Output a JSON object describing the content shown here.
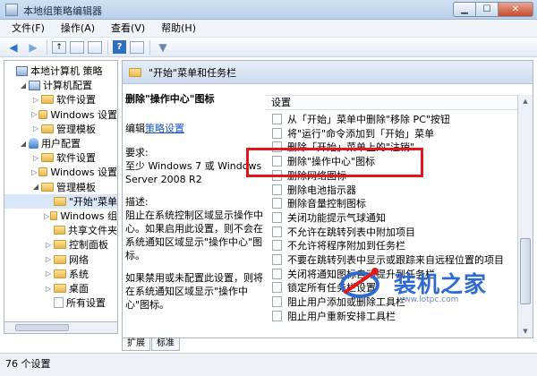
{
  "window": {
    "title": "本地组策略编辑器",
    "min_glyph": "▁",
    "max_glyph": "☐",
    "close_glyph": "✕"
  },
  "menu": [
    "文件(F)",
    "操作(A)",
    "查看(V)",
    "帮助(H)"
  ],
  "toolbar": {
    "back_glyph": "◀",
    "forward_glyph": "▶",
    "up_glyph": "↑",
    "help_glyph": "?",
    "filter_glyph": "▼"
  },
  "tree": {
    "expanded_glyph": "◢",
    "collapsed_glyph": "▷",
    "items": [
      {
        "label": "本地计算机 策略",
        "depth": 0,
        "toggle": "",
        "icon": "computer-icon"
      },
      {
        "label": "计算机配置",
        "depth": 1,
        "toggle": "expanded",
        "icon": "computer-icon"
      },
      {
        "label": "软件设置",
        "depth": 2,
        "toggle": "collapsed",
        "icon": "folder-icon"
      },
      {
        "label": "Windows 设置",
        "depth": 2,
        "toggle": "collapsed",
        "icon": "folder-icon"
      },
      {
        "label": "管理模板",
        "depth": 2,
        "toggle": "collapsed",
        "icon": "folder-icon"
      },
      {
        "label": "用户配置",
        "depth": 1,
        "toggle": "expanded",
        "icon": "user-icon"
      },
      {
        "label": "软件设置",
        "depth": 2,
        "toggle": "collapsed",
        "icon": "folder-icon"
      },
      {
        "label": "Windows 设置",
        "depth": 2,
        "toggle": "collapsed",
        "icon": "folder-icon"
      },
      {
        "label": "管理模板",
        "depth": 2,
        "toggle": "expanded",
        "icon": "folder-icon"
      },
      {
        "label": "\"开始\"菜单",
        "depth": 3,
        "toggle": "",
        "icon": "folder-icon",
        "selected": true
      },
      {
        "label": "Windows 组",
        "depth": 3,
        "toggle": "collapsed",
        "icon": "folder-icon"
      },
      {
        "label": "共享文件夹",
        "depth": 3,
        "toggle": "",
        "icon": "folder-icon"
      },
      {
        "label": "控制面板",
        "depth": 3,
        "toggle": "collapsed",
        "icon": "folder-icon"
      },
      {
        "label": "网络",
        "depth": 3,
        "toggle": "collapsed",
        "icon": "folder-icon"
      },
      {
        "label": "系统",
        "depth": 3,
        "toggle": "collapsed",
        "icon": "folder-icon"
      },
      {
        "label": "桌面",
        "depth": 3,
        "toggle": "collapsed",
        "icon": "folder-icon"
      },
      {
        "label": "所有设置",
        "depth": 3,
        "toggle": "",
        "icon": "file-icon"
      }
    ]
  },
  "right_pane": {
    "header_title": "\"开始\"菜单和任务栏",
    "description": {
      "heading": "删除\"操作中心\"图标",
      "edit_prefix": "编辑",
      "edit_link": "策略设置",
      "requirements_label": "要求:",
      "requirements_text": "至少 Windows 7 或 Windows Server 2008 R2",
      "description_label": "描述:",
      "description_text": "阻止在系统控制区域显示操作中心。如果启用此设置，则不会在系统通知区域显示\"操作中心\"图标。",
      "description_text2": "如果禁用或未配置此设置，则将在系统通知区域显示\"操作中心\"图标。"
    },
    "list_header": "设置",
    "settings": [
      "从「开始」菜单中删除\"移除 PC\"按钮",
      "将\"运行\"命令添加到「开始」菜单",
      "删除「开始」菜单上的\"注销\"",
      "删除\"操作中心\"图标",
      "删除网络图标",
      "删除电池指示器",
      "删除音量控制图标",
      "关闭功能提示气球通知",
      "不允许在跳转列表中附加项目",
      "不允许将程序附加到任务栏",
      "不要在跳转列表中显示或跟踪来自远程位置的项目",
      "关闭将通知图标自动提升到任务栏",
      "锁定所有任务栏设置",
      "阻止用户添加或删除工具栏",
      "阻止用户重新安排工具栏"
    ],
    "scroll_up_glyph": "▲",
    "scroll_down_glyph": "▼"
  },
  "tabs": [
    "扩展",
    "标准"
  ],
  "status": "76 个设置",
  "watermark": {
    "text": "装机之家",
    "url": "www.lotpc.com"
  }
}
